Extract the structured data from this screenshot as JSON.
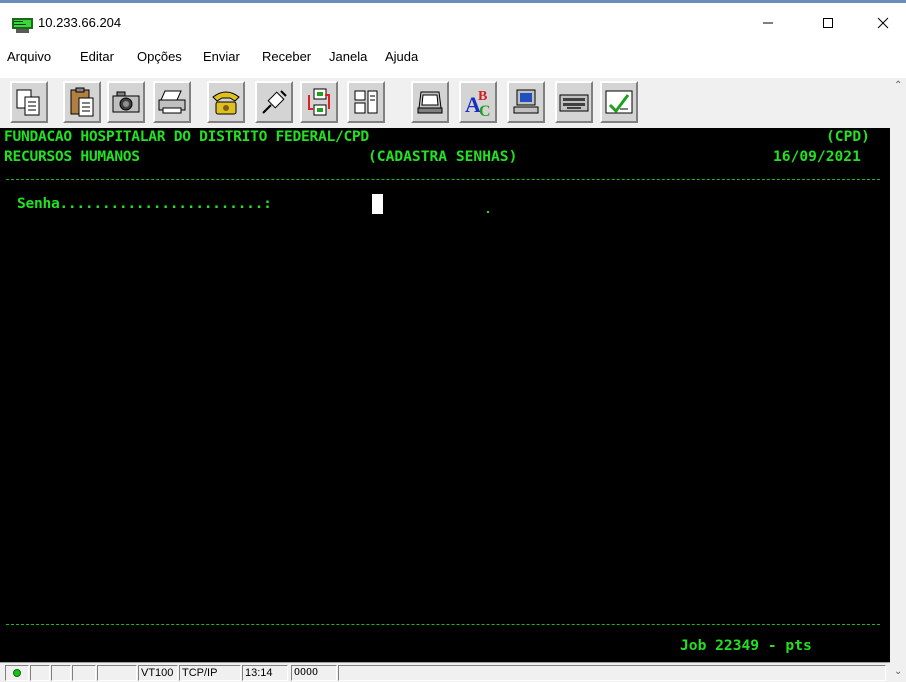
{
  "window": {
    "title": "10.233.66.204",
    "icon": "terminal-icon",
    "controls": [
      "minimize-icon",
      "maximize-icon",
      "close-icon"
    ]
  },
  "menu": [
    "Arquivo",
    "Editar",
    "Opções",
    "Enviar",
    "Receber",
    "Janela",
    "Ajuda"
  ],
  "toolbar": [
    "copy-icon",
    "paste-icon",
    "camera-icon",
    "print-icon",
    "phone-icon",
    "connect-icon",
    "transfer-icon",
    "layout-icon",
    "document-stack-icon",
    "spellcheck-icon",
    "computer-icon",
    "keyboard-icon",
    "checklist-icon"
  ],
  "terminal": {
    "header_line1_left": "FUNDACAO HOSPITALAR DO DISTRITO FEDERAL/CPD",
    "header_line1_right": "(CPD)",
    "header_line2_left": "RECURSOS HUMANOS",
    "header_line2_center": "(CADASTRA SENHAS)",
    "header_line2_right": "16/09/2021",
    "password_label": "Senha........................:",
    "password_value": "",
    "footer_right": "Job 22349 - pts",
    "colors": {
      "background": "#000000",
      "text": "#22e022"
    }
  },
  "status": {
    "emulation": "VT100",
    "protocol": "TCP/IP",
    "time": "13:14",
    "indicator": "OOOO"
  }
}
